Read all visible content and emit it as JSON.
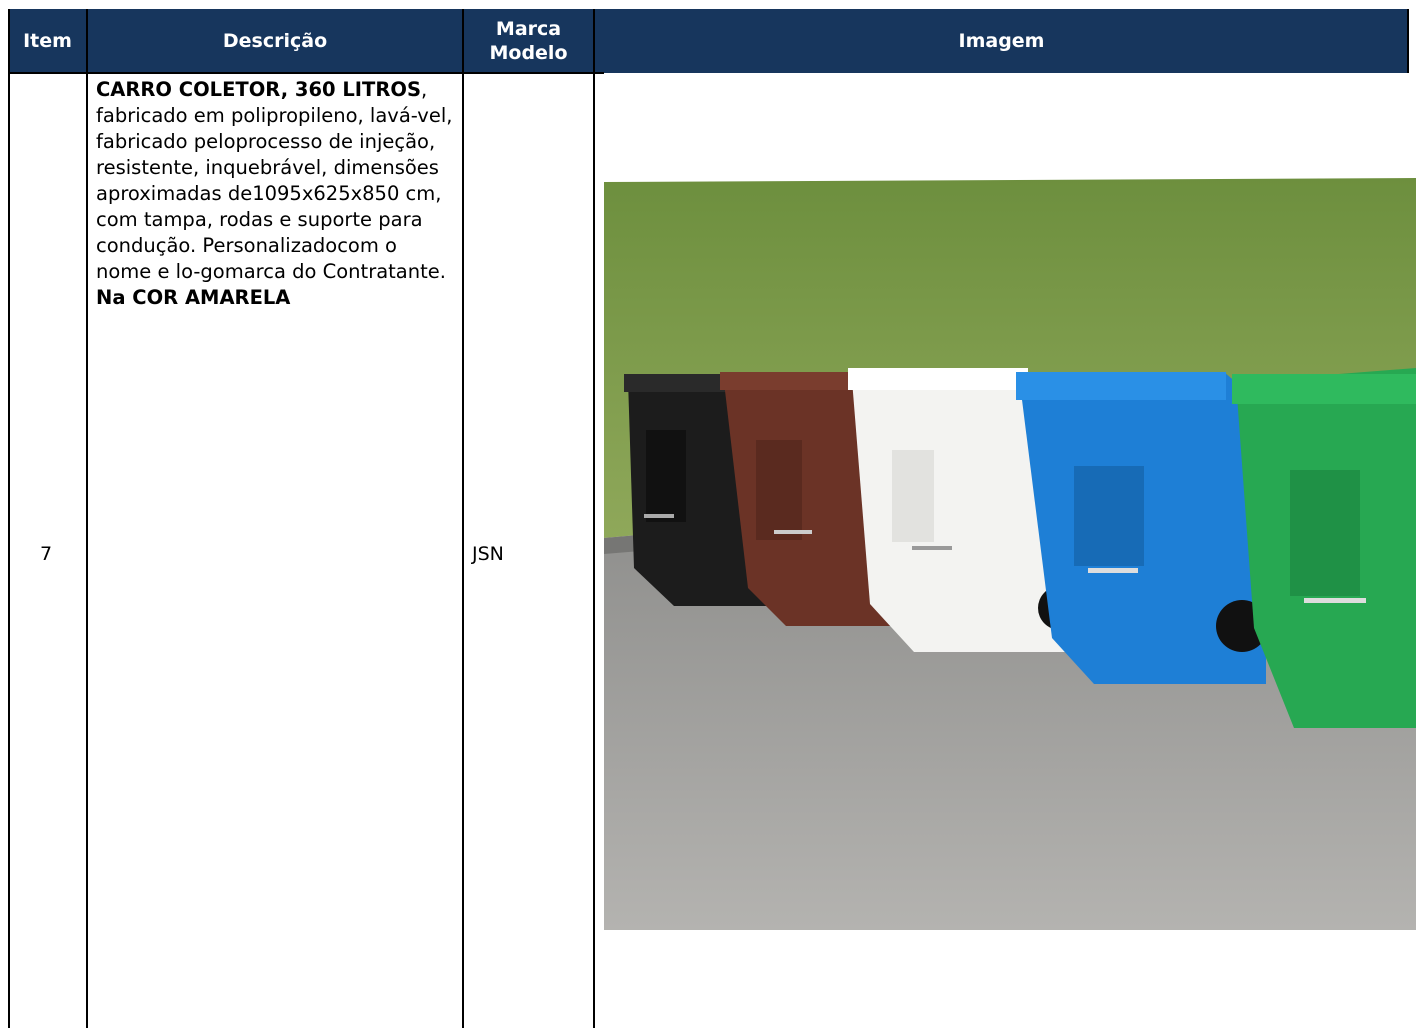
{
  "table": {
    "headers": {
      "item": "Item",
      "descricao": "Descrição",
      "marca_line1": "Marca",
      "marca_line2": "Modelo",
      "imagem": "Imagem"
    },
    "row": {
      "item": "7",
      "description": {
        "bold_title": "CARRO COLETOR, 360 LITROS",
        "comma": ",",
        "body": " fabricado em polipropileno, lavá-vel, fabricado peloprocesso de injeção, resistente, inquebrável, dimensões aproximadas de1095x625x850 cm, com tampa, rodas e suporte para condução. Personalizadocom o nome e lo-gomarca do Contratante. ",
        "bold_color": "Na COR AMARELA"
      },
      "marca": "JSN",
      "image_subject": "colored-waste-bins-photo"
    }
  },
  "colors": {
    "header_bg": "#17365d",
    "header_text": "#ffffff",
    "bins": [
      "#1c1c1c",
      "#6b3326",
      "#f3f3f1",
      "#1e7fd6",
      "#27a852"
    ]
  }
}
